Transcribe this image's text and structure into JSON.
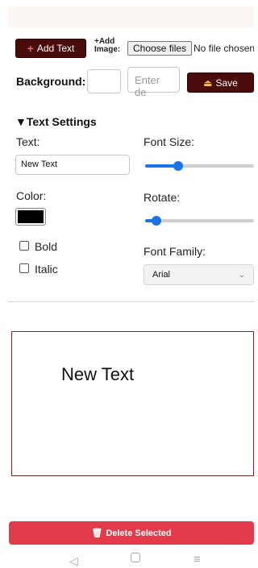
{
  "toolbar": {
    "add_text_label": "Add Text",
    "add_image_label_line1": "+Add",
    "add_image_label_line2": "Image:",
    "choose_files_label": "Choose files",
    "file_status": "No file chosen"
  },
  "background": {
    "label": "Background:",
    "text_placeholder": "Enter de",
    "save_label": "Save"
  },
  "text_settings": {
    "header": "▼Text Settings",
    "text_label": "Text:",
    "text_value": "New Text",
    "font_size_label": "Font Size:",
    "font_size_slider_level": 0.3,
    "color_label": "Color:",
    "color_value": "#000000",
    "rotate_label": "Rotate:",
    "rotate_slider_level": 0.1,
    "bold_label": "Bold",
    "italic_label": "Italic",
    "font_family_label": "Font Family:",
    "font_family_value": "Arial"
  },
  "canvas": {
    "text": "New Text"
  },
  "actions": {
    "delete_label": "Delete Selected"
  },
  "colors": {
    "accent_dark": "#4a0b0b",
    "danger": "#e33b49",
    "slider": "#1a73e8"
  },
  "icons": [
    "plus-icon",
    "upload-icon",
    "trash-icon",
    "dropdown-chevron-icon",
    "nav-back-icon",
    "nav-home-icon",
    "nav-menu-icon"
  ]
}
